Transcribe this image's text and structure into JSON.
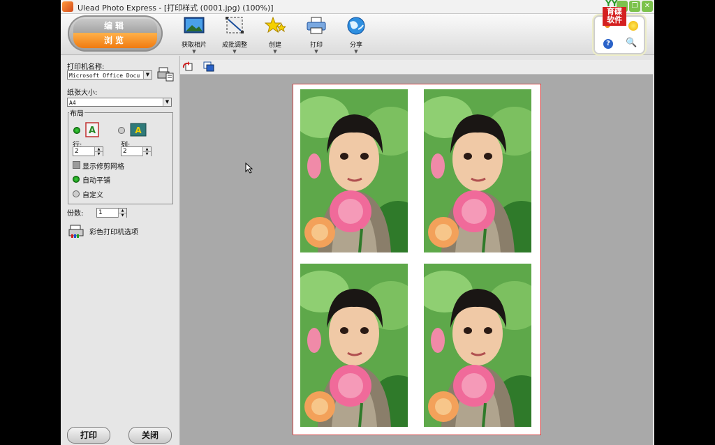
{
  "window": {
    "title": "Ulead Photo Express - [打印样式 (0001.jpg)  (100%)]"
  },
  "logo": {
    "top_text": "YY",
    "red_text": "育碟\n软件"
  },
  "mode": {
    "edit_label": "编辑",
    "browse_label": "浏览"
  },
  "toolbar": {
    "tools": [
      {
        "label": "获取相片",
        "icon": "photo-icon"
      },
      {
        "label": "成批调整",
        "icon": "batch-adjust-icon"
      },
      {
        "label": "创建",
        "icon": "create-star-icon"
      },
      {
        "label": "打印",
        "icon": "printer-icon"
      },
      {
        "label": "分享",
        "icon": "share-globe-icon"
      }
    ]
  },
  "help": {
    "help_glyph": "?",
    "search_glyph": "🔍"
  },
  "panel": {
    "printer_label": "打印机名称:",
    "printer_value": "Microsoft Office Docu",
    "paper_label": "纸张大小:",
    "paper_value": "A4",
    "layout_title": "布局",
    "rows_label": "行:",
    "rows_value": "2",
    "cols_label": "列:",
    "cols_value": "2",
    "show_grid_label": "显示修剪网格",
    "auto_tile_label": "自动平铺",
    "custom_label": "自定义",
    "copies_label": "份数:",
    "copies_value": "1",
    "color_options_label": "彩色打印机选项",
    "print_button": "打印",
    "close_button": "关闭"
  },
  "colors": {
    "accent_orange": "#f07a10",
    "radio_green": "#0a7a0a",
    "page_border": "#d04040"
  }
}
